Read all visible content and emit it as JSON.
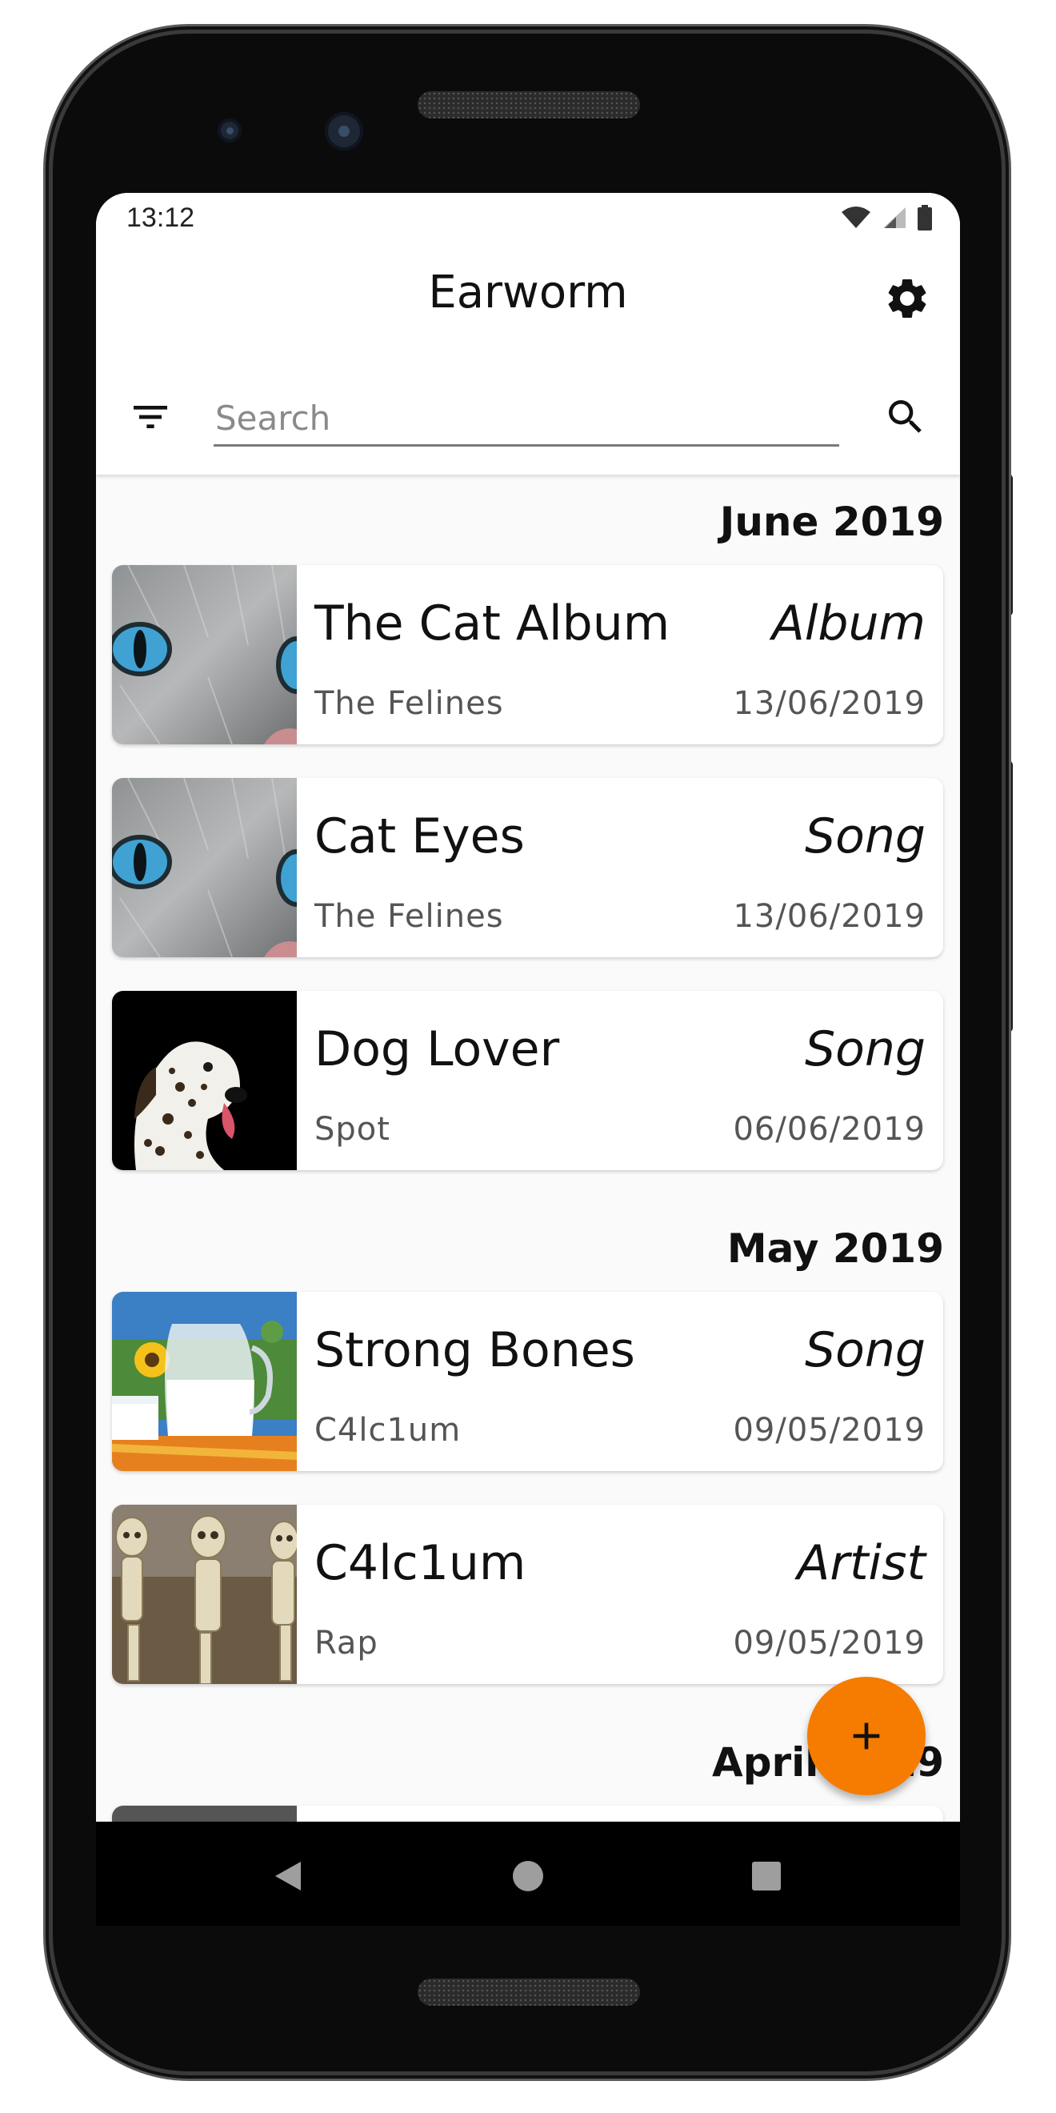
{
  "status_bar": {
    "time": "13:12"
  },
  "app_bar": {
    "title": "Earworm"
  },
  "search": {
    "placeholder": "Search",
    "value": ""
  },
  "sections": [
    {
      "header": "June 2019"
    },
    {
      "header": "May 2019"
    },
    {
      "header": "April 2019"
    }
  ],
  "items": [
    {
      "title": "The Cat Album",
      "type": "Album",
      "subtitle": "The Felines",
      "date": "13/06/2019",
      "thumbnail": "cat-eyes-image"
    },
    {
      "title": "Cat Eyes",
      "type": "Song",
      "subtitle": "The Felines",
      "date": "13/06/2019",
      "thumbnail": "cat-eyes-image"
    },
    {
      "title": "Dog Lover",
      "type": "Song",
      "subtitle": "Spot",
      "date": "06/06/2019",
      "thumbnail": "dalmatian-image"
    },
    {
      "title": "Strong Bones",
      "type": "Song",
      "subtitle": "C4lc1um",
      "date": "09/05/2019",
      "thumbnail": "milk-jug-image"
    },
    {
      "title": "C4lc1um",
      "type": "Artist",
      "subtitle": "Rap",
      "date": "09/05/2019",
      "thumbnail": "skeletons-image"
    }
  ],
  "fab": {
    "icon": "plus-icon"
  },
  "colors": {
    "accent": "#f57c00",
    "background": "#fafafa",
    "card": "#ffffff"
  }
}
